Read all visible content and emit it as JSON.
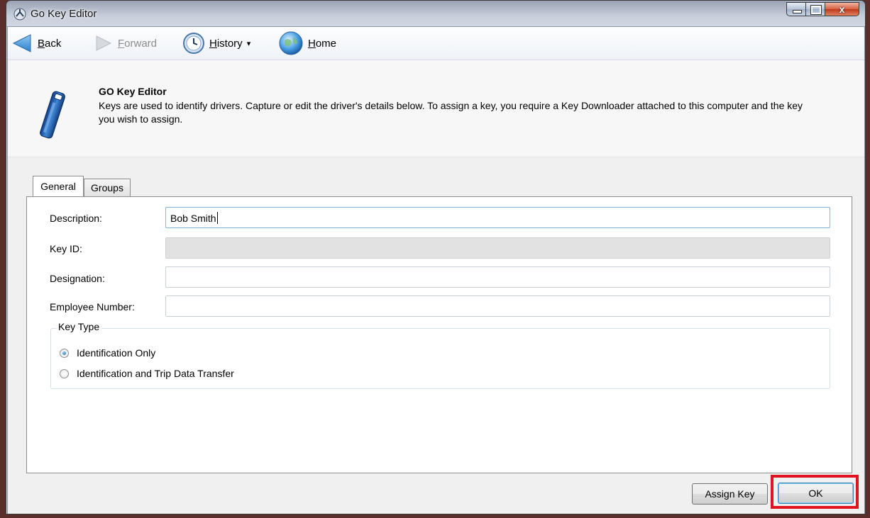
{
  "window": {
    "title": "Go Key Editor",
    "close_glyph": "x"
  },
  "nav": {
    "back_label": "Back",
    "back_mnemonic": "B",
    "back_rest": "ack",
    "forward_mnemonic": "F",
    "forward_rest": "orward",
    "history_mnemonic": "H",
    "history_rest": "istory",
    "history_caret": "▾",
    "home_mnemonic": "H",
    "home_rest": "ome"
  },
  "header": {
    "title": "GO Key Editor",
    "description": "Keys are used to identify drivers. Capture or edit the driver's details below. To assign a key, you require a Key Downloader attached to this computer and the key you wish to assign."
  },
  "tabs": [
    {
      "label": "General",
      "active": true
    },
    {
      "label": "Groups",
      "active": false
    }
  ],
  "form": {
    "description_label": "Description:",
    "description_value": "Bob Smith",
    "key_id_label": "Key ID:",
    "key_id_value": "",
    "designation_label": "Designation:",
    "designation_value": "",
    "employee_number_label": "Employee Number:",
    "employee_number_value": ""
  },
  "key_type": {
    "title": "Key Type",
    "options": [
      {
        "label": "Identification Only",
        "checked": true
      },
      {
        "label": "Identification and Trip Data Transfer",
        "checked": false
      }
    ]
  },
  "buttons": {
    "assign_key": "Assign Key",
    "ok": "OK"
  },
  "colors": {
    "highlight": "#e0141f",
    "accent": "#3c7fb1"
  }
}
